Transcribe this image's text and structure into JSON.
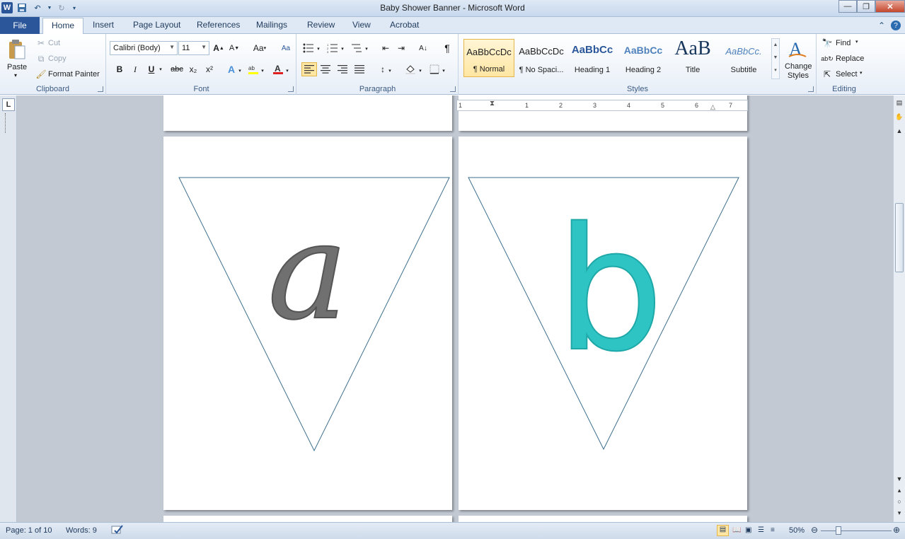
{
  "window": {
    "title": "Baby Shower Banner  -  Microsoft Word"
  },
  "tabs": {
    "file": "File",
    "home": "Home",
    "insert": "Insert",
    "page_layout": "Page Layout",
    "references": "References",
    "mailings": "Mailings",
    "review": "Review",
    "view": "View",
    "acrobat": "Acrobat"
  },
  "clipboard": {
    "paste": "Paste",
    "cut": "Cut",
    "copy": "Copy",
    "format_painter": "Format Painter",
    "label": "Clipboard"
  },
  "font": {
    "name": "Calibri (Body)",
    "size": "11",
    "label": "Font",
    "bold": "B",
    "italic": "I",
    "underline": "U",
    "strike": "abc",
    "sub": "x₂",
    "sup": "x²",
    "change_case": "Aa"
  },
  "paragraph": {
    "label": "Paragraph",
    "pilcrow": "¶"
  },
  "styles": {
    "label": "Styles",
    "items": [
      {
        "sample": "AaBbCcDc",
        "name": "¶ Normal"
      },
      {
        "sample": "AaBbCcDc",
        "name": "¶ No Spaci..."
      },
      {
        "sample": "AaBbCc",
        "name": "Heading 1"
      },
      {
        "sample": "AaBbCc",
        "name": "Heading 2"
      },
      {
        "sample": "AaB",
        "name": "Title"
      },
      {
        "sample": "AaBbCc.",
        "name": "Subtitle"
      }
    ],
    "change_styles": "Change Styles"
  },
  "editing": {
    "find": "Find",
    "replace": "Replace",
    "select": "Select",
    "label": "Editing"
  },
  "ruler": {
    "numbers": [
      "1",
      "1",
      "2",
      "3",
      "4",
      "5",
      "6",
      "7"
    ]
  },
  "pages": {
    "left_letter": "a",
    "right_letter": "b",
    "colors": {
      "letter_a": "#707070",
      "letter_b": "#2ec4c4",
      "triangle_stroke": "#3d6f8f"
    }
  },
  "status": {
    "page": "Page: 1 of 10",
    "words": "Words: 9",
    "zoom": "50%"
  }
}
